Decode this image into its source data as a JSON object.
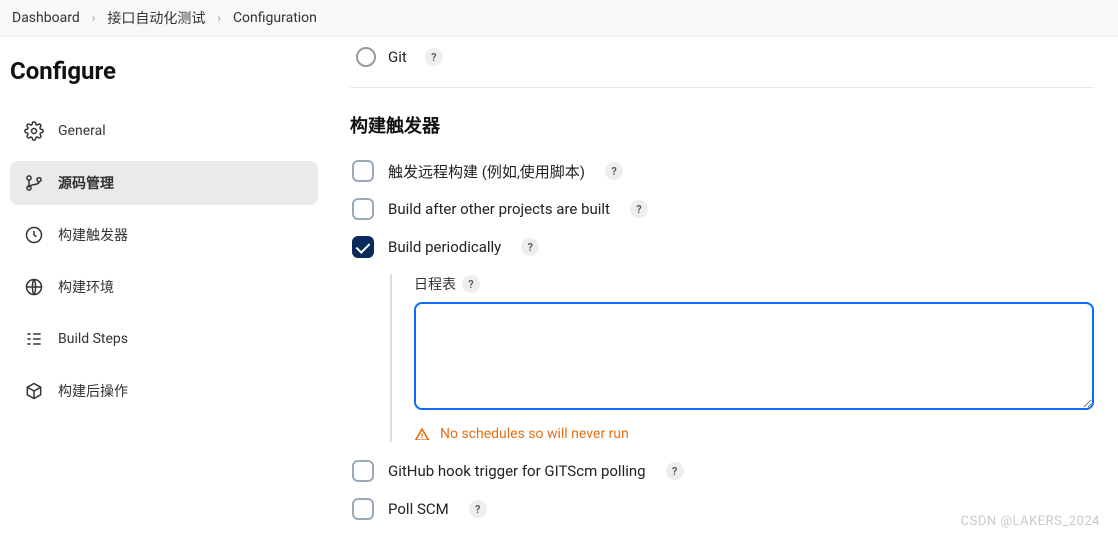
{
  "breadcrumb": {
    "items": [
      "Dashboard",
      "接口自动化测试",
      "Configuration"
    ]
  },
  "page_title": "Configure",
  "sidebar": {
    "items": [
      {
        "label": "General"
      },
      {
        "label": "源码管理"
      },
      {
        "label": "构建触发器"
      },
      {
        "label": "构建环境"
      },
      {
        "label": "Build Steps"
      },
      {
        "label": "构建后操作"
      }
    ]
  },
  "scm": {
    "git_label": "Git"
  },
  "triggers": {
    "section_title": "构建触发器",
    "remote_label": "触发远程构建 (例如,使用脚本)",
    "after_projects_label": "Build after other projects are built",
    "periodically_label": "Build periodically",
    "schedule_label": "日程表",
    "schedule_value": "",
    "warning_text": "No schedules so will never run",
    "github_hook_label": "GitHub hook trigger for GITScm polling",
    "poll_scm_label": "Poll SCM"
  },
  "help_glyph": "?",
  "watermark": "CSDN @LAKERS_2024"
}
